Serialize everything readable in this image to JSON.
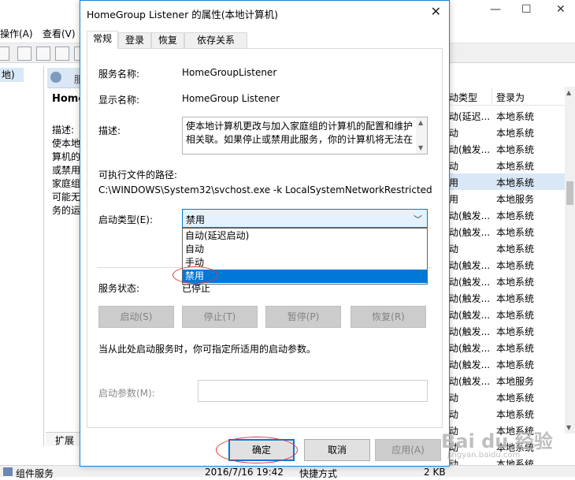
{
  "background": {
    "menu": [
      "操作(A)",
      "查看(V)"
    ],
    "tree_item": "地)",
    "desc_header": "服",
    "desc_title": "Home",
    "desc_lines": [
      "描述:",
      "使本地",
      "算机的",
      "或禁用",
      "家庭组",
      "可能无",
      "务的运"
    ],
    "bottom_tab": "扩展",
    "columns": [
      "动类型",
      "登录为"
    ],
    "rows": [
      {
        "type": "动(延迟...",
        "logon": "本地系统"
      },
      {
        "type": "动",
        "logon": "本地系统"
      },
      {
        "type": "动(触发...",
        "logon": "本地系统"
      },
      {
        "type": "动",
        "logon": "本地系统"
      },
      {
        "type": "用",
        "logon": "本地系统"
      },
      {
        "type": "用",
        "logon": "本地服务"
      },
      {
        "type": "动(触发...",
        "logon": "本地系统"
      },
      {
        "type": "动(触发...",
        "logon": "本地系统"
      },
      {
        "type": "动",
        "logon": "本地系统"
      },
      {
        "type": "动(触发...",
        "logon": "本地系统"
      },
      {
        "type": "动(触发...",
        "logon": "本地系统"
      },
      {
        "type": "动(触发...",
        "logon": "本地系统"
      },
      {
        "type": "动(触发...",
        "logon": "本地系统"
      },
      {
        "type": "动(触发...",
        "logon": "本地系统"
      },
      {
        "type": "动(触发...",
        "logon": "本地系统"
      },
      {
        "type": "动(触发...",
        "logon": "本地系统"
      },
      {
        "type": "动(触发...",
        "logon": "本地服务"
      },
      {
        "type": "动",
        "logon": "本地系统"
      },
      {
        "type": "动",
        "logon": "本地系统"
      },
      {
        "type": "动",
        "logon": "本地系统"
      },
      {
        "type": "动",
        "logon": "本地系统"
      },
      {
        "type": "动",
        "logon": "本地系统"
      }
    ],
    "status_bar": {
      "name": "组件服务",
      "date": "2016/7/16 19:42",
      "kind": "快捷方式",
      "size": "2 KB"
    }
  },
  "dialog": {
    "title": "HomeGroup Listener 的属性(本地计算机)",
    "tabs": [
      "常规",
      "登录",
      "恢复",
      "依存关系"
    ],
    "service_name_label": "服务名称:",
    "service_name": "HomeGroupListener",
    "display_name_label": "显示名称:",
    "display_name": "HomeGroup Listener",
    "description_label": "描述:",
    "description": "使本地计算机更改与加入家庭组的计算机的配置和维护相关联。如果停止或禁用此服务，你的计算机将无法在",
    "exe_path_label": "可执行文件的路径:",
    "exe_path": "C:\\WINDOWS\\System32\\svchost.exe -k LocalSystemNetworkRestricted",
    "startup_type_label": "启动类型(E):",
    "startup_type_value": "禁用",
    "startup_options": [
      "自动(延迟启动)",
      "自动",
      "手动",
      "禁用"
    ],
    "service_status_label": "服务状态:",
    "service_status": "已停止",
    "buttons": [
      "启动(S)",
      "停止(T)",
      "暂停(P)",
      "恢复(R)"
    ],
    "hint": "当从此处启动服务时，你可指定所适用的启动参数。",
    "start_params_label": "启动参数(M):",
    "ok": "确定",
    "cancel": "取消",
    "apply": "应用(A)"
  },
  "watermark": {
    "logo": "Bai du 经验",
    "url": "jingyan.baidu.com"
  }
}
